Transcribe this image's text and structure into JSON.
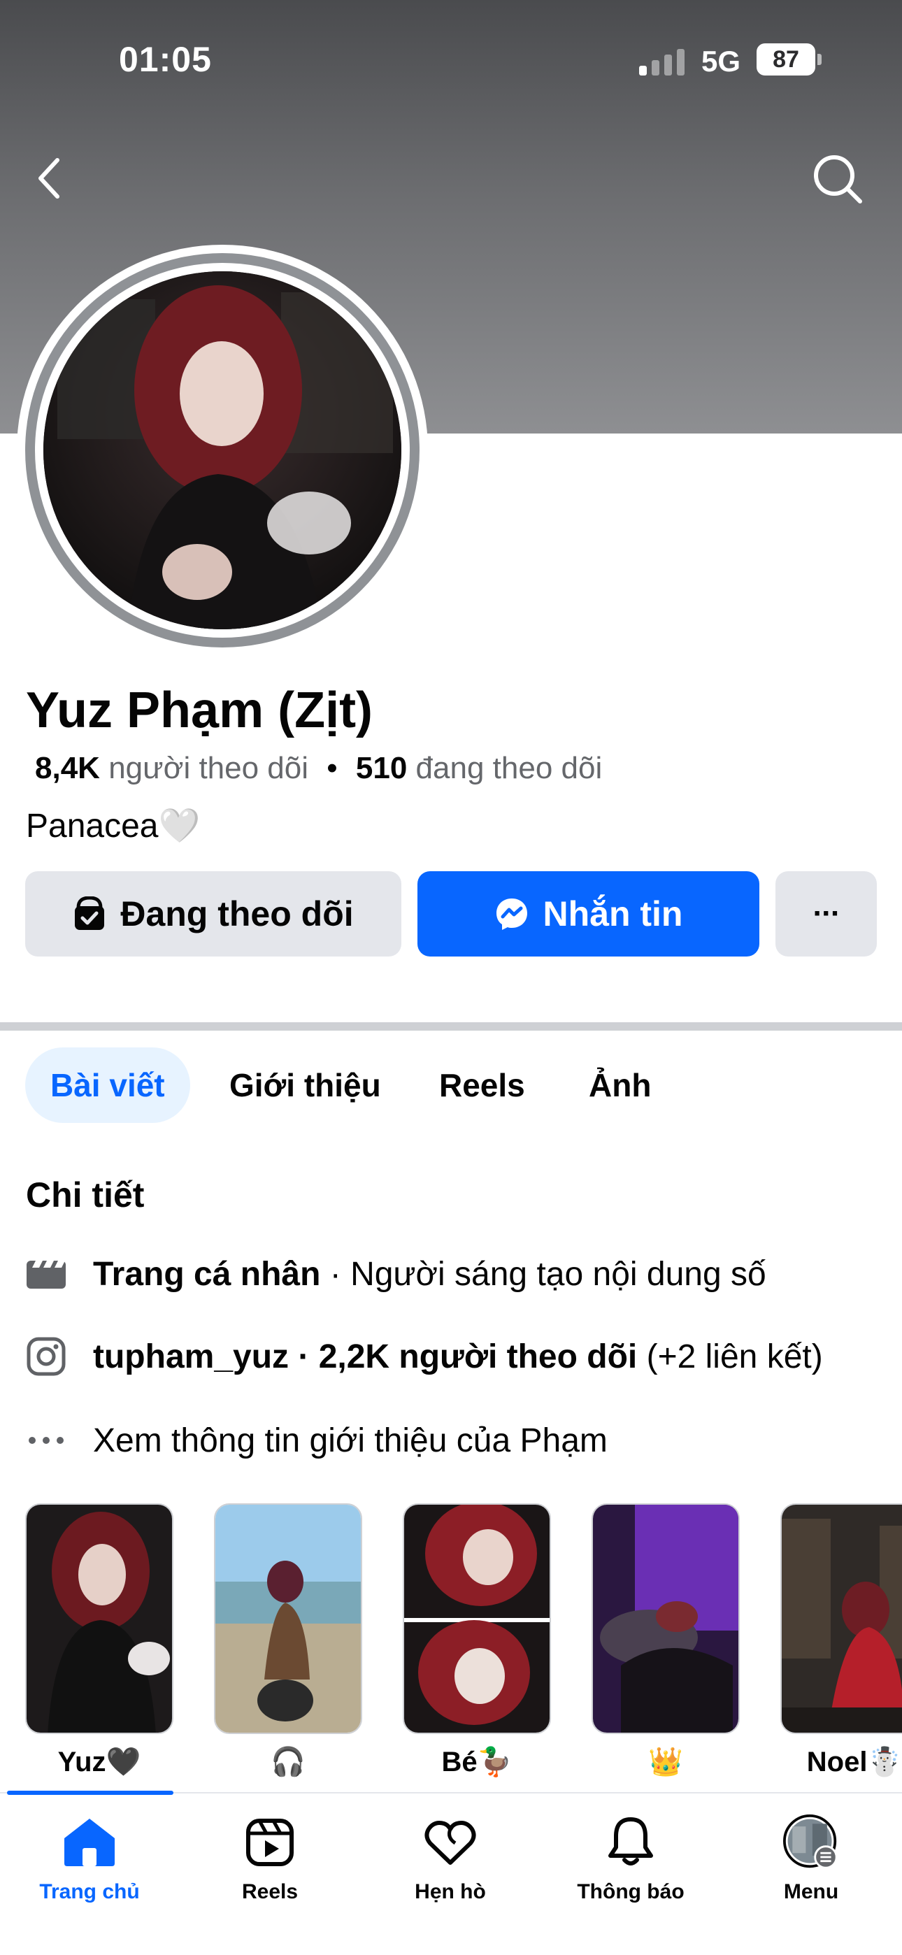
{
  "status_bar": {
    "time": "01:05",
    "network": "5G",
    "battery": "87"
  },
  "profile": {
    "name": "Yuz Phạm (Zịt)",
    "followers_count": "8,4K",
    "followers_label": "người theo dõi",
    "separator": "•",
    "following_count": "510",
    "following_label": "đang theo dõi",
    "bio": "Panacea🤍"
  },
  "actions": {
    "follow_label": "Đang theo dõi",
    "message_label": "Nhắn tin",
    "more_label": "···"
  },
  "tabs": [
    {
      "label": "Bài viết",
      "active": true
    },
    {
      "label": "Giới thiệu",
      "active": false
    },
    {
      "label": "Reels",
      "active": false
    },
    {
      "label": "Ảnh",
      "active": false
    }
  ],
  "details": {
    "title": "Chi tiết",
    "rows": [
      {
        "icon": "profile-page-icon",
        "bold": "Trang cá nhân",
        "rest": " · Người sáng tạo nội dung số"
      },
      {
        "icon": "instagram-icon",
        "bold": "tupham_yuz · 2,2K người theo dõi",
        "rest": " (+2 liên kết)"
      },
      {
        "icon": "more-dots-icon",
        "bold": "",
        "rest": "Xem thông tin giới thiệu của Phạm"
      }
    ]
  },
  "stories": [
    {
      "caption": "Yuz🖤"
    },
    {
      "caption": "🎧"
    },
    {
      "caption": "Bé🦆"
    },
    {
      "caption": "👑"
    },
    {
      "caption": "Noel☃️"
    }
  ],
  "bottom_nav": [
    {
      "label": "Trang chủ",
      "icon": "home-icon",
      "active": true
    },
    {
      "label": "Reels",
      "icon": "reels-icon",
      "active": false
    },
    {
      "label": "Hẹn hò",
      "icon": "dating-heart-icon",
      "active": false
    },
    {
      "label": "Thông báo",
      "icon": "bell-icon",
      "active": false
    },
    {
      "label": "Menu",
      "icon": "menu-avatar-icon",
      "active": false
    }
  ],
  "colors": {
    "accent": "#0866ff",
    "button_gray": "#e4e6eb",
    "secondary_text": "#65676b",
    "active_tab_bg": "#e7f3ff"
  }
}
